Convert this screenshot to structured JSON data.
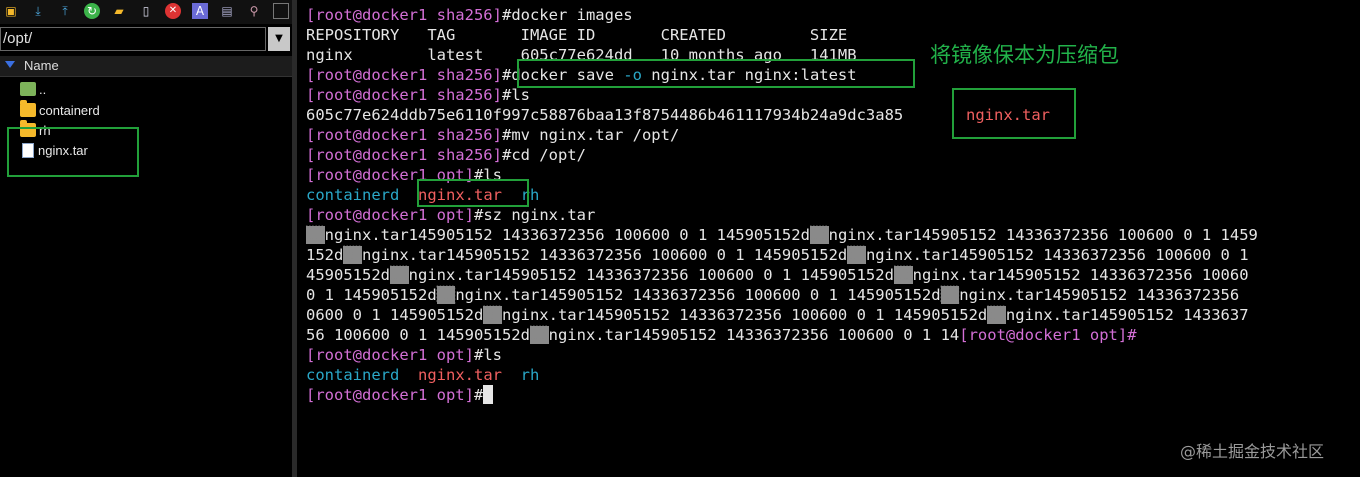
{
  "toolbar": {
    "icons": [
      "open-folder-icon",
      "download-icon",
      "upload-icon",
      "refresh-icon",
      "new-folder-icon",
      "new-file-icon",
      "delete-icon",
      "rename-icon",
      "properties-icon",
      "wand-icon",
      "terminal-icon"
    ]
  },
  "file_pane": {
    "path": "/opt/",
    "column_header": "Name",
    "items": [
      {
        "name": "..",
        "icon": "parent-folder-icon"
      },
      {
        "name": "containerd",
        "icon": "folder-icon"
      },
      {
        "name": "rh",
        "icon": "folder-icon"
      },
      {
        "name": "nginx.tar",
        "icon": "file-icon"
      }
    ]
  },
  "terminal": {
    "prompt_sha": "[root@docker1 sha256]",
    "prompt_opt": "[root@docker1 opt]",
    "cmd_images": "docker images",
    "images_header": "REPOSITORY   TAG       IMAGE ID       CREATED         SIZE",
    "images_row": "nginx        latest    605c77e624dd   10 months ago   141MB",
    "cmd_save_a": "docker save ",
    "cmd_save_flag": "-o",
    "cmd_save_b": " nginx.tar nginx:latest",
    "cmd_ls": "ls",
    "hash_line": "605c77e624ddb75e6110f997c58876baa13f8754486b461117934b24a9dc3a85",
    "hash_file": "nginx.tar",
    "cmd_mv": "mv nginx.tar /opt/",
    "cmd_cd": "cd /opt/",
    "ls1": {
      "a": "containerd",
      "b": "nginx.tar",
      "c": "rh"
    },
    "cmd_sz": "sz nginx.tar",
    "garble": [
      [
        "#",
        "nginx.tar145905152 14336372356 100600 0 1 145905152d",
        "#",
        "nginx.tar145905152 14336372356 100600 0 1 1459"
      ],
      [
        "152d",
        "#",
        "nginx.tar145905152 14336372356 100600 0 1 145905152d",
        "#",
        "nginx.tar145905152 14336372356 100600 0 1"
      ],
      [
        "45905152d",
        "#",
        "nginx.tar145905152 14336372356 100600 0 1 145905152d",
        "#",
        "nginx.tar145905152 14336372356 10060"
      ],
      [
        "0 1 145905152d",
        "#",
        "nginx.tar145905152 14336372356 100600 0 1 145905152d",
        "#",
        "nginx.tar145905152 14336372356"
      ],
      [
        "0600 0 1 145905152d",
        "#",
        "nginx.tar145905152 14336372356 100600 0 1 145905152d",
        "#",
        "nginx.tar145905152 1433637"
      ],
      [
        "56 100600 0 1 145905152d",
        "#",
        "nginx.tar145905152 14336372356 100600 0 1 14"
      ]
    ],
    "garble_tail_prompt": "[root@docker1 opt]#",
    "ls2": {
      "a": "containerd",
      "b": "nginx.tar",
      "c": "rh"
    }
  },
  "annotation": "将镜像保本为压缩包",
  "watermark": "@稀土掘金技术社区",
  "colors": {
    "prompt": "#d36fd6",
    "dir": "#2aa8c8",
    "archive": "#f06060",
    "highlight": "#22a03a"
  }
}
